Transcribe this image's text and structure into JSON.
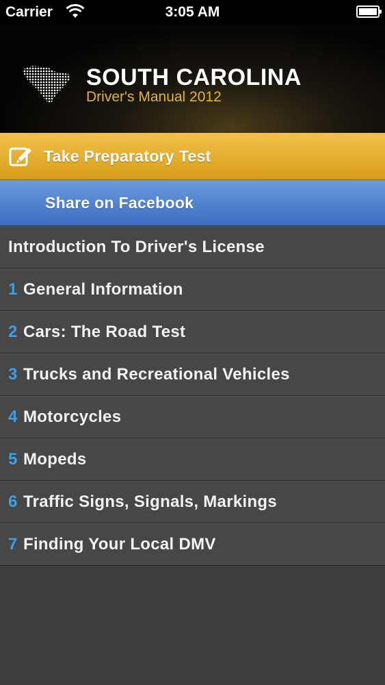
{
  "status_bar": {
    "carrier": "Carrier",
    "time": "3:05 AM"
  },
  "header": {
    "title": "SOUTH CAROLINA",
    "subtitle": "Driver's Manual 2012",
    "accent_color": "#e3b430"
  },
  "actions": {
    "test_label": "Take Preparatory Test",
    "facebook_label": "Share on Facebook"
  },
  "menu": {
    "intro": "Introduction To Driver's License",
    "items": [
      {
        "num": "1",
        "label": "General Information"
      },
      {
        "num": "2",
        "label": "Cars: The Road Test"
      },
      {
        "num": "3",
        "label": "Trucks and Recreational Vehicles"
      },
      {
        "num": "4",
        "label": "Motorcycles"
      },
      {
        "num": "5",
        "label": "Mopeds"
      },
      {
        "num": "6",
        "label": "Traffic Signs, Signals, Markings"
      },
      {
        "num": "7",
        "label": "Finding Your Local DMV"
      }
    ]
  },
  "icons": [
    "wifi-icon",
    "battery-icon",
    "state-map-icon",
    "edit-icon"
  ]
}
